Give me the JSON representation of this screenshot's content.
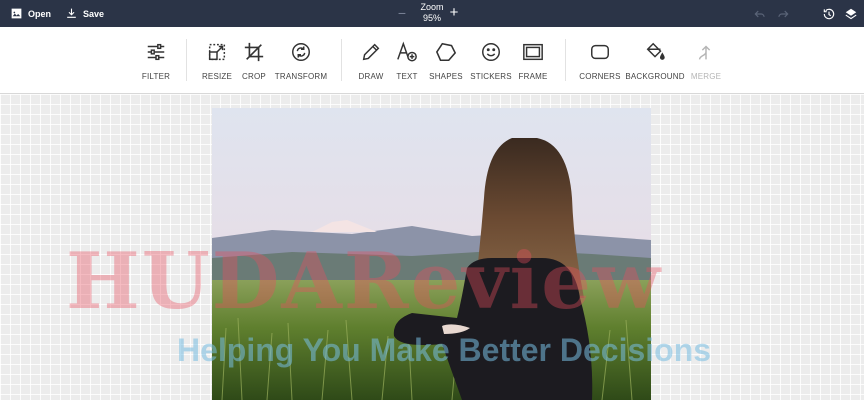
{
  "topbar": {
    "open_label": "Open",
    "save_label": "Save",
    "zoom_label": "Zoom",
    "zoom_value": "95%",
    "zoom_out_symbol": "−",
    "zoom_in_symbol": "+",
    "icons": [
      "image-icon",
      "download-icon",
      "undo-icon",
      "redo-icon",
      "history-icon",
      "layers-icon"
    ]
  },
  "toolbar": {
    "filter": "FILTER",
    "resize": "RESIZE",
    "crop": "CROP",
    "transform": "TRANSFORM",
    "draw": "DRAW",
    "text": "TEXT",
    "shapes": "SHAPES",
    "stickers": "STICKERS",
    "frame": "FRAME",
    "corners": "CORNERS",
    "background": "BACKGROUND",
    "merge": "MERGE"
  },
  "watermark": {
    "brand": "HUDAReview",
    "tagline": "Helping You Make Better Decisions"
  },
  "colors": {
    "topbar_bg": "#2b3447",
    "toolbar_bg": "#ffffff",
    "canvas_bg": "#ececec"
  }
}
